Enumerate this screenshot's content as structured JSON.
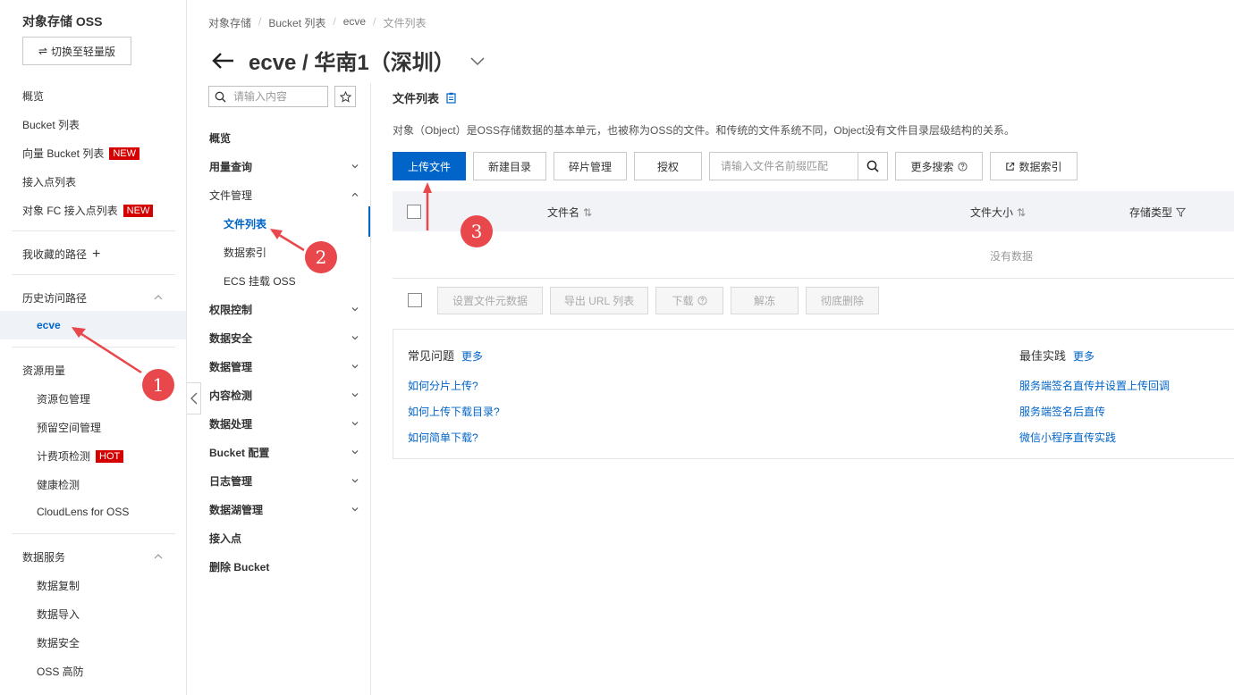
{
  "sidebar": {
    "title": "对象存储 OSS",
    "switch_label": "切换至轻量版",
    "items": [
      {
        "label": "概览"
      },
      {
        "label": "Bucket 列表"
      },
      {
        "label": "向量 Bucket 列表",
        "badge": "NEW"
      },
      {
        "label": "接入点列表"
      },
      {
        "label": "对象 FC 接入点列表",
        "badge": "NEW"
      }
    ],
    "favorites_label": "我收藏的路径",
    "history_label": "历史访问路径",
    "history_active": "ecve",
    "resource_group": {
      "label": "资源用量",
      "items": [
        {
          "label": "资源包管理"
        },
        {
          "label": "预留空间管理"
        },
        {
          "label": "计费项检测",
          "badge": "HOT"
        },
        {
          "label": "健康检测"
        },
        {
          "label": "CloudLens for OSS"
        }
      ]
    },
    "data_service": {
      "label": "数据服务",
      "items": [
        {
          "label": "数据复制"
        },
        {
          "label": "数据导入"
        },
        {
          "label": "数据安全"
        },
        {
          "label": "OSS 高防"
        }
      ]
    }
  },
  "breadcrumb": [
    "对象存储",
    "Bucket 列表",
    "ecve",
    "文件列表"
  ],
  "page_title": "ecve / 华南1（深圳）",
  "sub_nav": {
    "search_placeholder": "请输入内容",
    "items": {
      "overview": "概览",
      "usage": "用量查询",
      "file_mgmt": "文件管理",
      "file_list": "文件列表",
      "data_index": "数据索引",
      "ecs_mount": "ECS 挂载 OSS",
      "access_ctrl": "权限控制",
      "data_security": "数据安全",
      "data_mgmt": "数据管理",
      "content_detect": "内容检测",
      "data_process": "数据处理",
      "bucket_config": "Bucket 配置",
      "log_mgmt": "日志管理",
      "datalake_mgmt": "数据湖管理",
      "access_point": "接入点",
      "delete_bucket": "删除 Bucket"
    }
  },
  "main": {
    "section_title": "文件列表",
    "description": "对象（Object）是OSS存储数据的基本单元，也被称为OSS的文件。和传统的文件系统不同，Object没有文件目录层级结构的关系。",
    "toolbar": {
      "upload": "上传文件",
      "new_dir": "新建目录",
      "fragments": "碎片管理",
      "authorize": "授权",
      "search_placeholder": "请输入文件名前缀匹配",
      "more_search": "更多搜索",
      "data_index": "数据索引"
    },
    "table": {
      "headers": {
        "name": "文件名",
        "size": "文件大小",
        "storage": "存储类型"
      },
      "empty": "没有数据"
    },
    "bulk_actions": {
      "set_meta": "设置文件元数据",
      "export_url": "导出 URL 列表",
      "download": "下载",
      "unfreeze": "解冻",
      "delete": "彻底删除"
    },
    "faq": {
      "title": "常见问题",
      "more": "更多",
      "links": [
        "如何分片上传?",
        "如何上传下载目录?",
        "如何简单下载?"
      ]
    },
    "best_practice": {
      "title": "最佳实践",
      "more": "更多",
      "links": [
        "服务端签名直传并设置上传回调",
        "服务端签名后直传",
        "微信小程序直传实践"
      ]
    }
  },
  "annotations": {
    "m1": "1",
    "m2": "2",
    "m3": "3"
  },
  "colors": {
    "accent": "#0064c8",
    "marker": "#e8484c",
    "badge": "#d50000"
  }
}
